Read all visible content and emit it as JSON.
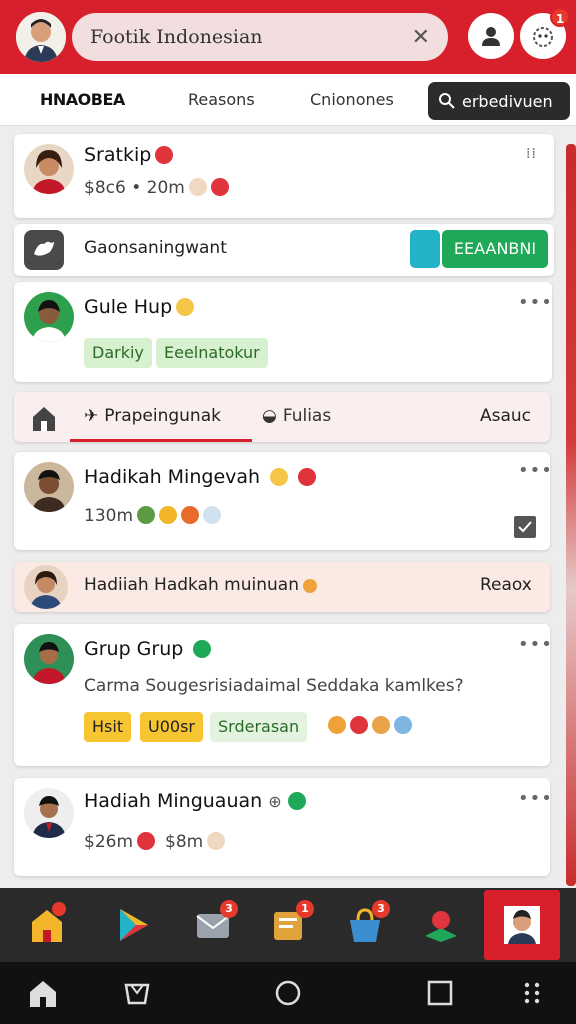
{
  "header": {
    "search_value": "Footik Indonesian",
    "notification_count": "1"
  },
  "tabs": {
    "items": [
      {
        "label": "HNAOBEA",
        "active": true
      },
      {
        "label": "Reasons",
        "active": false
      },
      {
        "label": "Cnionones",
        "active": false
      }
    ],
    "search_button": "erbedivuen"
  },
  "feed": {
    "post1": {
      "name": "Sratkip",
      "meta": "$8c6 • 20m"
    },
    "banner": {
      "label": "Gaonsaningwant",
      "action": "EEAANBNI"
    },
    "post2": {
      "name": "Gule Hup",
      "chips": [
        "Darkiy",
        "Eeelnatokur"
      ]
    },
    "tabrow": {
      "label1": "Prapeingunak",
      "label2": "Fulias",
      "label3": "Asauc"
    },
    "post3": {
      "name": "Hadikah Mingevah",
      "meta": "130m"
    },
    "strip": {
      "label": "Hadiiah Hadkah muinuan",
      "action": "Reaox"
    },
    "post4": {
      "name": "Grup Grup",
      "text": "Carma Sougesrisiadaimal Seddaka kamlkes?",
      "chips": [
        "Hsit",
        "U00sr",
        "Srderasan"
      ]
    },
    "post5": {
      "name": "Hadiah Minguauan",
      "meta1": "$26m",
      "meta2": "$8m"
    }
  },
  "colors": {
    "brand_red": "#d8202c",
    "green": "#1fa858",
    "teal": "#22b3c9",
    "chip_green": "#d7f0cf",
    "chip_yellow": "#f7c531"
  }
}
